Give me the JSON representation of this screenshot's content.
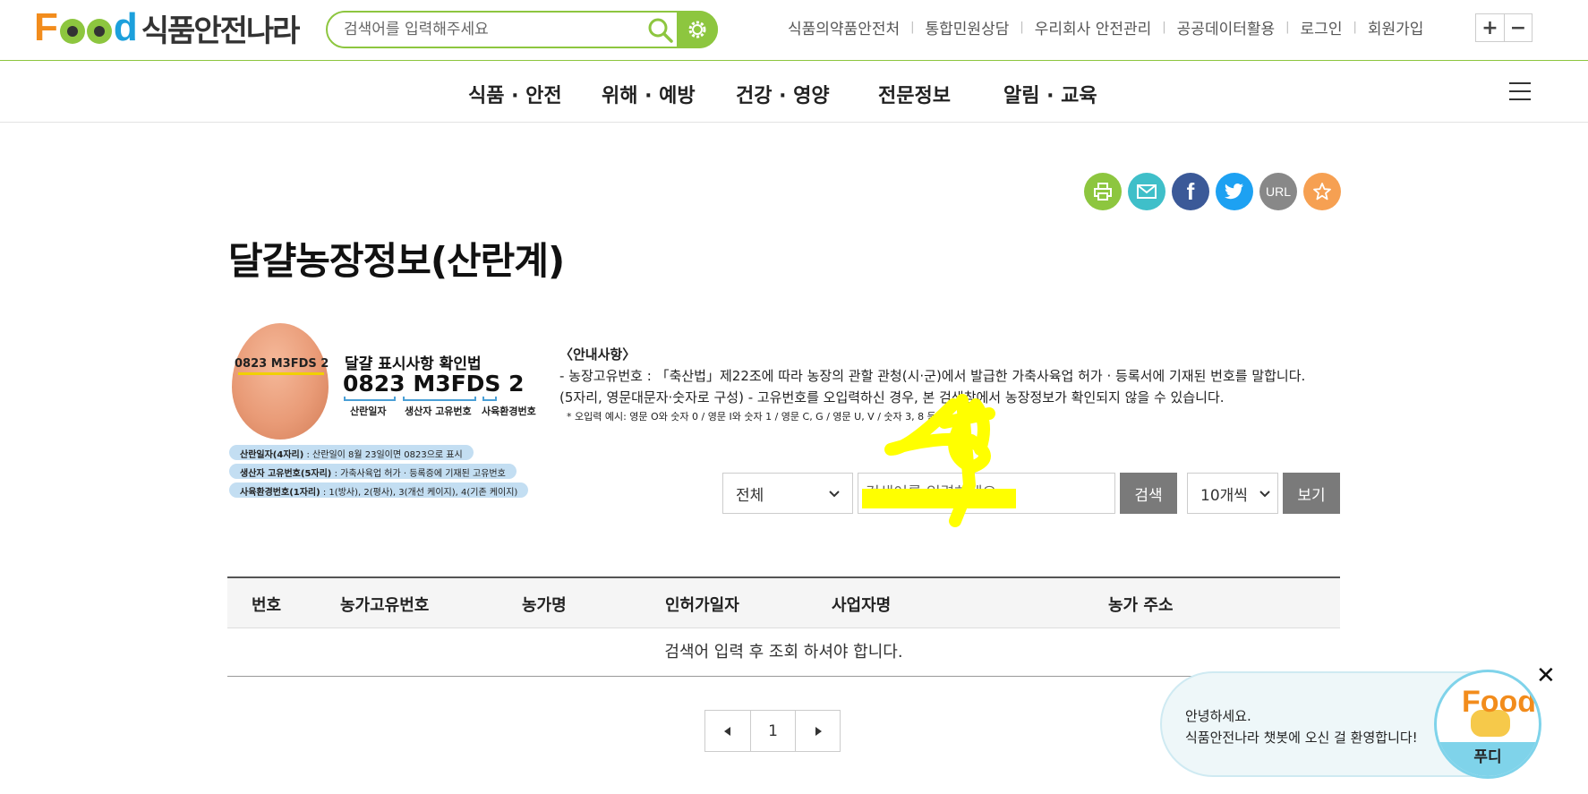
{
  "header": {
    "logo_text": "식품안전나라",
    "search_placeholder": "검색어를 입력해주세요",
    "util_links": [
      "식품의약품안전처",
      "통합민원상담",
      "우리회사 안전관리",
      "공공데이터활용",
      "로그인",
      "회원가입"
    ],
    "zoom_in": "+",
    "zoom_out": "−"
  },
  "nav": {
    "items": [
      "식품 · 안전",
      "위해 · 예방",
      "건강 · 영양",
      "전문정보",
      "알림 · 교육"
    ]
  },
  "share": {
    "url_label": "URL",
    "colors": [
      "#8dc63f",
      "#3fbfc9",
      "#3b5998",
      "#1da1f2",
      "#888888",
      "#f6a052"
    ]
  },
  "page": {
    "title": "달걀농장정보(산란계)"
  },
  "guide": {
    "egg_code": "0823 M3FDS 2",
    "title": "달걀 표시사항 확인법",
    "code_parts": [
      "0823",
      "M3FDS",
      "2"
    ],
    "code_labels": [
      "산란일자",
      "생산자 고유번호",
      "사육환경번호"
    ],
    "pills": [
      {
        "bold": "산란일자(4자리)",
        "text": " : 산란일이 8월 23일이면 0823으로 표시"
      },
      {
        "bold": "생산자 고유번호(5자리)",
        "text": " : 가축사육업 허가 · 등록증에 기재된 고유번호"
      },
      {
        "bold": "사육환경번호(1자리)",
        "text": " : 1(방사), 2(평사), 3(개선 케이지), 4(기존 케이지)"
      }
    ]
  },
  "notice": {
    "title": "〈안내사항〉",
    "line1": "- 농장고유번호 : 「축산법」제22조에 따라 농장의 관할 관청(시·군)에서 발급한 가축사육업 허가 · 등록서에 기재된 번호를 말합니다.",
    "line2": "(5자리, 영문대문자·숫자로 구성) - 고유번호를 오입력하신 경우, 본 검색창에서 농장정보가 확인되지 않을 수 있습니다.",
    "line3": "* 오입력 예시: 영문 O와 숫자 0 / 영문 I와 숫자 1 / 영문 C, G / 영문 U, V / 숫자 3, 8 등"
  },
  "search": {
    "category": "전체",
    "keyword_placeholder": "검색어를 입력하세요",
    "search_button": "검색",
    "page_size": "10개씩",
    "view_button": "보기"
  },
  "table": {
    "headers": [
      "번호",
      "농가고유번호",
      "농가명",
      "인허가일자",
      "사업자명",
      "농가 주소"
    ],
    "empty_message": "검색어 입력 후 조회 하셔야 합니다."
  },
  "pagination": {
    "current": "1"
  },
  "chatbot": {
    "greeting": "안녕하세요.",
    "welcome": "식품안전나라 챗봇에 오신 걸 환영합니다!",
    "name": "푸디",
    "logo": "Food",
    "close": "✕"
  }
}
